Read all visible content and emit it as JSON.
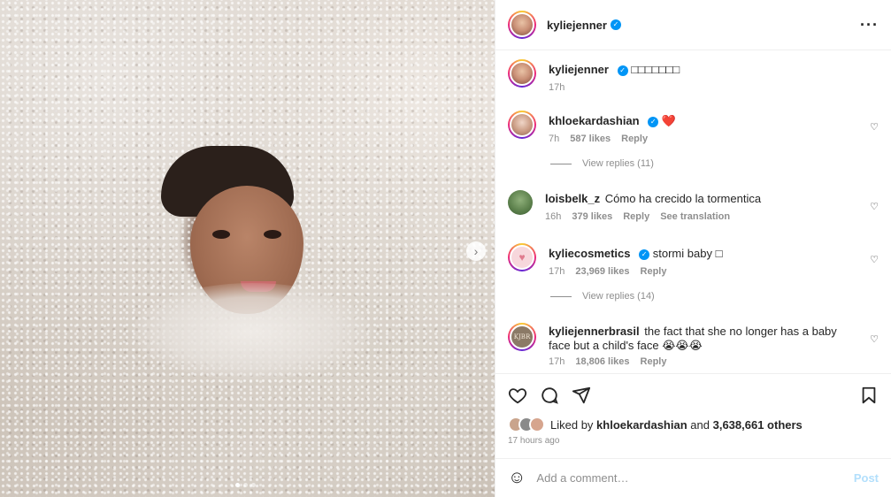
{
  "post": {
    "author": "kyliejenner",
    "caption": "□□□□□□□",
    "caption_time": "17h",
    "more_icon": "more-horizontal-icon",
    "carousel": {
      "total": 3,
      "active": 1,
      "next_icon": "chevron-right-icon"
    }
  },
  "comments": [
    {
      "user": "khloekardashian",
      "verified": true,
      "text": "❤️",
      "time": "7h",
      "likes": "587 likes",
      "reply": "Reply",
      "view_replies": "View replies (11)"
    },
    {
      "user": "loisbelk_z",
      "verified": false,
      "text": "Cómo ha crecido la tormentica",
      "time": "16h",
      "likes": "379 likes",
      "reply": "Reply",
      "translate": "See translation"
    },
    {
      "user": "kyliecosmetics",
      "verified": true,
      "text": "stormi baby □",
      "time": "17h",
      "likes": "23,969 likes",
      "reply": "Reply",
      "view_replies": "View replies (14)"
    },
    {
      "user": "kyliejennerbrasil",
      "verified": false,
      "text": "the fact that she no longer has a baby face but a child's face 😭😭😭",
      "time": "17h",
      "likes": "18,806 likes",
      "reply": "Reply",
      "avatar_text": "KJBR"
    }
  ],
  "actions": {
    "like_icon": "heart-icon",
    "comment_icon": "comment-icon",
    "share_icon": "send-icon",
    "save_icon": "bookmark-icon"
  },
  "likes": {
    "prefix": "Liked by",
    "first_user": "khloekardashian",
    "and": "and",
    "others": "3,638,661 others",
    "posted": "17 hours ago"
  },
  "add_comment": {
    "emoji_icon": "smiley-icon",
    "placeholder": "Add a comment…",
    "post_label": "Post"
  },
  "colors": {
    "verified": "#0095f6",
    "heart": "#e0245e",
    "post_disabled": "#b2dffc"
  }
}
